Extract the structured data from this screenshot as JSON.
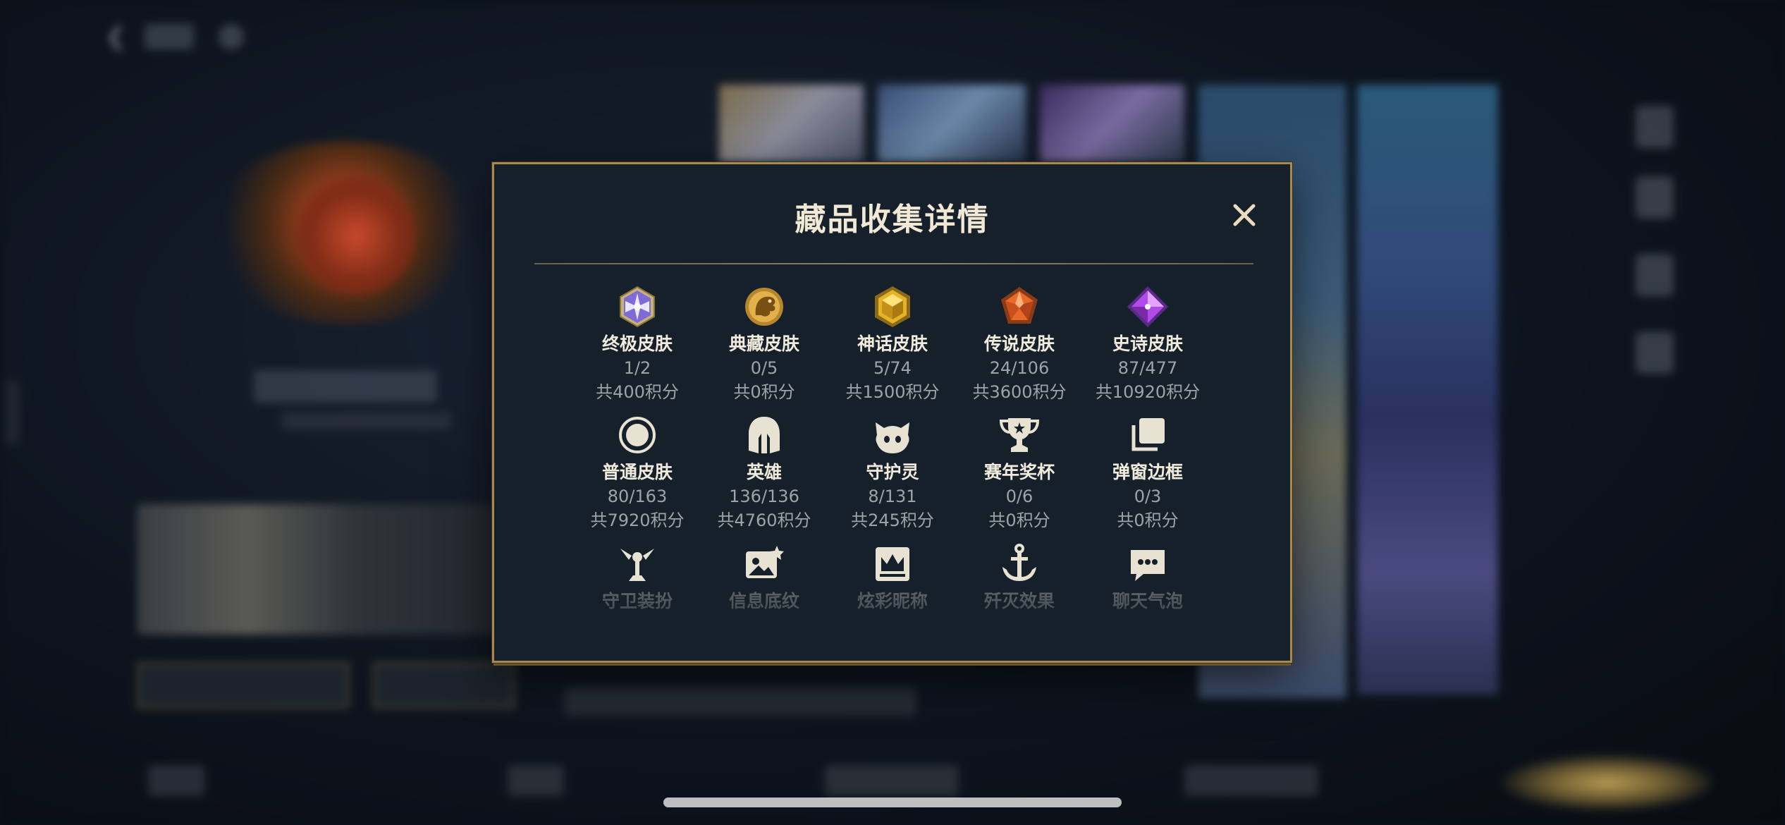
{
  "modal": {
    "title": "藏品收集详情",
    "close_icon": "close-icon",
    "accent_color": "#a88a4e",
    "rows": [
      [
        {
          "icon": "ultimate-skin-icon",
          "name": "终极皮肤",
          "count": "1/2",
          "points": "共400积分"
        },
        {
          "icon": "treasured-skin-icon",
          "name": "典藏皮肤",
          "count": "0/5",
          "points": "共0积分"
        },
        {
          "icon": "mythic-skin-icon",
          "name": "神话皮肤",
          "count": "5/74",
          "points": "共1500积分"
        },
        {
          "icon": "legendary-skin-icon",
          "name": "传说皮肤",
          "count": "24/106",
          "points": "共3600积分"
        },
        {
          "icon": "epic-skin-icon",
          "name": "史诗皮肤",
          "count": "87/477",
          "points": "共10920积分"
        }
      ],
      [
        {
          "icon": "standard-skin-icon",
          "name": "普通皮肤",
          "count": "80/163",
          "points": "共7920积分"
        },
        {
          "icon": "champion-helmet-icon",
          "name": "英雄",
          "count": "136/136",
          "points": "共4760积分"
        },
        {
          "icon": "little-legend-icon",
          "name": "守护灵",
          "count": "8/131",
          "points": "共245积分"
        },
        {
          "icon": "trophy-icon",
          "name": "赛年奖杯",
          "count": "0/6",
          "points": "共0积分"
        },
        {
          "icon": "frame-stack-icon",
          "name": "弹窗边框",
          "count": "0/3",
          "points": "共0积分"
        }
      ],
      [
        {
          "icon": "ward-skin-icon",
          "name": "守卫装扮"
        },
        {
          "icon": "banner-icon",
          "name": "信息底纹"
        },
        {
          "icon": "crown-nameplate-icon",
          "name": "炫彩昵称"
        },
        {
          "icon": "anchor-icon",
          "name": "歼灭效果"
        },
        {
          "icon": "chat-bubble-icon",
          "name": "聊天气泡"
        }
      ]
    ]
  }
}
